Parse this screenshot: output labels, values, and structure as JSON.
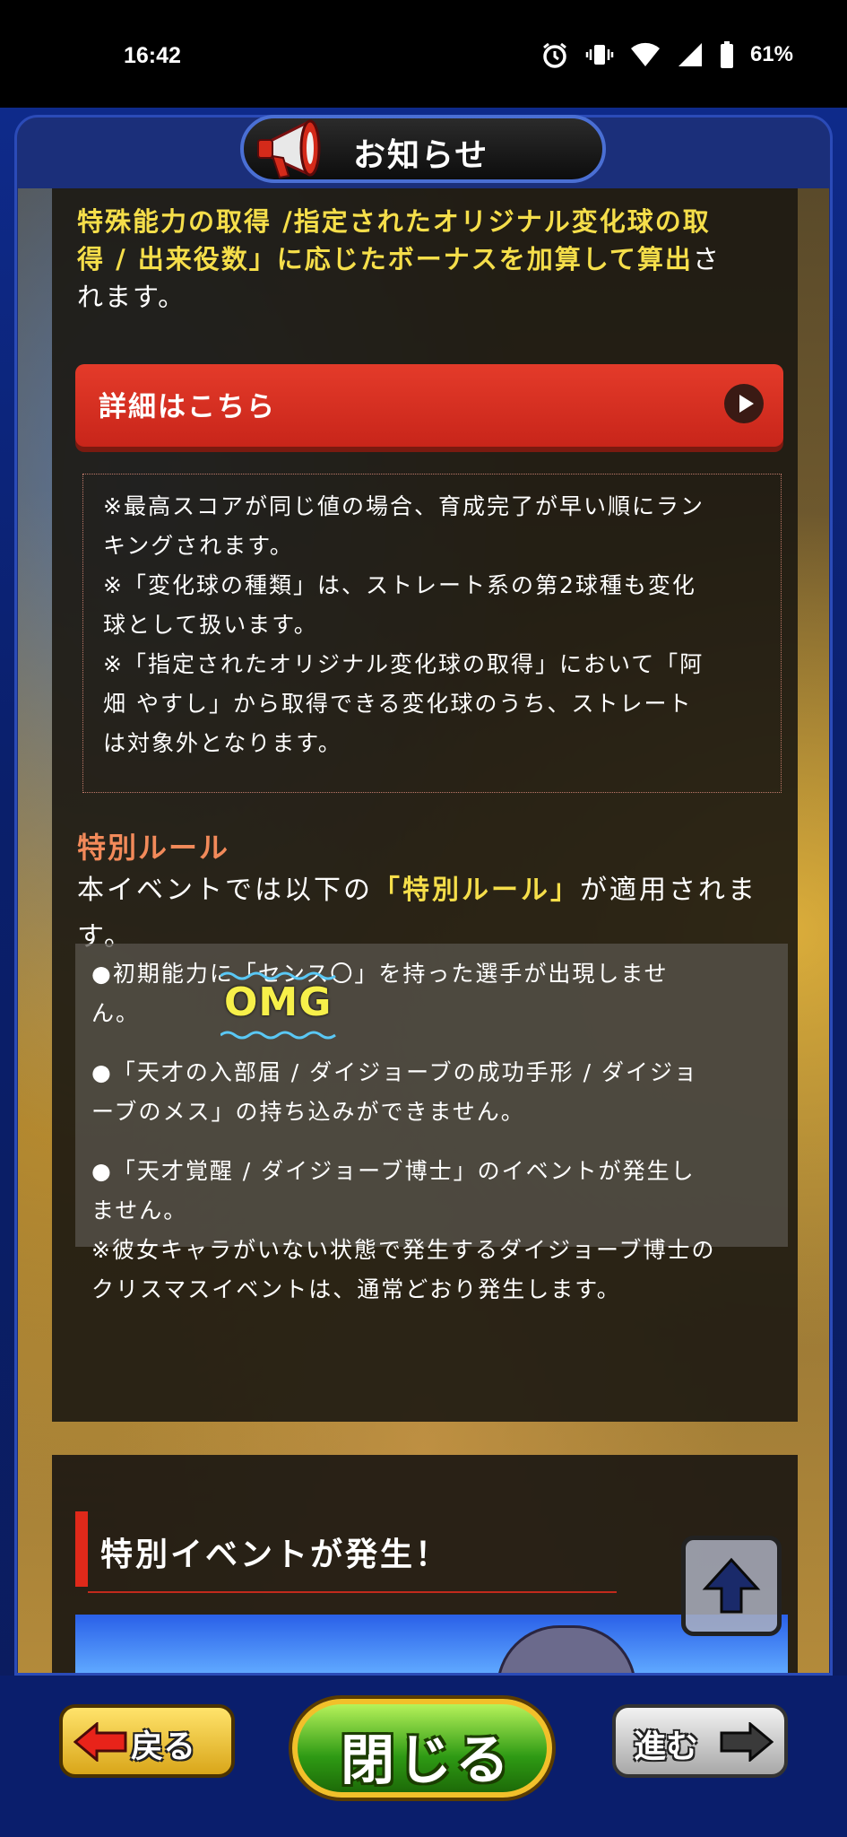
{
  "status_bar": {
    "time": "16:42",
    "battery": "61%"
  },
  "header": {
    "title": "お知らせ"
  },
  "intro": {
    "line1": "特殊能力の取得 /指定されたオリジナル変化球の取",
    "line2_highlight": "得 / 出来役数」に応じたボーナスを加算して算出",
    "line2_rest": "さ",
    "line3": "れます。"
  },
  "detail_button": {
    "label": "詳細はこちら"
  },
  "notes": [
    "※最高スコアが同じ値の場合、育成完了が早い順にラン",
    "キングされます。",
    "※「変化球の種類」は、ストレート系の第2球種も変化",
    "球として扱います。",
    "※「指定されたオリジナル変化球の取得」において「阿",
    "畑 やすし」から取得できる変化球のうち、ストレート",
    "は対象外となります。"
  ],
  "special_rule": {
    "heading": "特別ルール",
    "body_pre": "本イベントでは以下の",
    "body_highlight": "「特別ルール」",
    "body_post": "が適用されま",
    "body_line2": "す。"
  },
  "rules": [
    "●初期能力に「センス〇」を持った選手が出現しませ",
    "ん。",
    "●「天才の入部届 / ダイジョーブの成功手形 / ダイジョ",
    "ーブのメス」の持ち込みができません。",
    "●「天才覚醒 / ダイジョーブ博士」のイベントが発生し",
    "ません。",
    "※彼女キャラがいない状態で発生するダイジョーブ博士の",
    "クリスマスイベントは、通常どおり発生します。"
  ],
  "overlay_text": "OMG",
  "section2": {
    "title": "特別イベントが発生！"
  },
  "bottom_nav": {
    "back": "戻る",
    "close": "閉じる",
    "forward": "進む"
  },
  "colors": {
    "accent_red": "#e0291a",
    "highlight_yellow": "#f5de4a",
    "rule_orange": "#f28a5a"
  }
}
